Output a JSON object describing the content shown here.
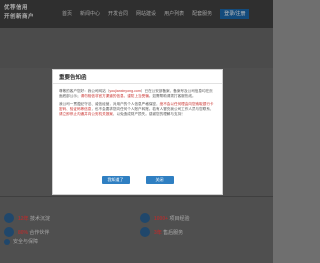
{
  "logo": {
    "line1": "优荐信用",
    "line2": "开创新商户"
  },
  "nav": {
    "items": [
      "首页",
      "新闻中心",
      "开发合同",
      "网站建设",
      "用户列表",
      "配套服务"
    ],
    "cta": "登录/注册"
  },
  "stats": [
    {
      "num": "12年",
      "label": "技术沉淀"
    },
    {
      "num": "1000+",
      "label": "项目经验"
    },
    {
      "num": "80%",
      "label": "合作伙伴"
    },
    {
      "num": "3年",
      "label": "售后服务"
    }
  ],
  "footer_note": "安全与保障",
  "modal": {
    "title": "重要告知函",
    "para1_a": "尊敬的客户您好：我公司网站（",
    "para1_b": "youjianxinyong.com",
    "para1_c": "）已在公安部备案，备案号及公司信息均在页面底部公示；",
    "para1_d": "请勿相信非官方渠道的信息，谨防上当受骗",
    "para1_e": "。如需帮助请拨打客服热线。",
    "para2_a": "我公司一贯遵纪守法、诚信经营，对用户的个人信息严格保密，",
    "para2_b": "绝不会以任何理由向您索取银行卡密码、验证码等信息",
    "para2_c": "，也不会要求您向任何个人账户转账。若有人冒充我公司工作人员与您联系，",
    "para2_d": "请立即停止沟通并向公安机关报案",
    "para2_e": "，以免造成财产损失。感谢您的理解与支持！",
    "btn_ok": "我知道了",
    "btn_close": "关闭"
  }
}
